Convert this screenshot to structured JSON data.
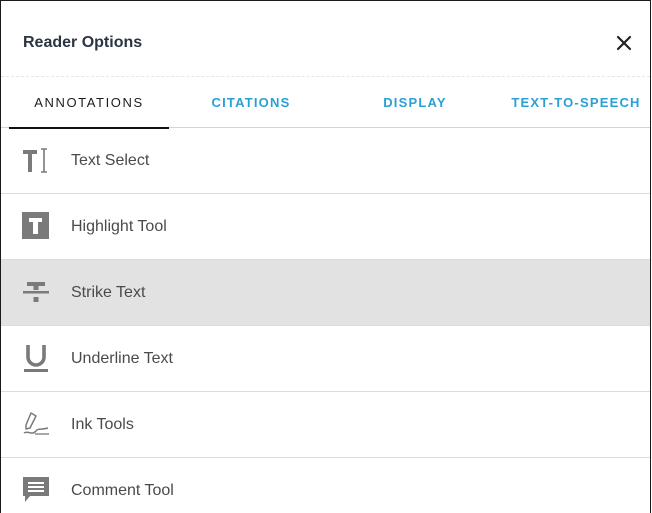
{
  "header": {
    "title": "Reader Options",
    "close_icon": "close-icon"
  },
  "tabs": [
    {
      "label": "ANNOTATIONS",
      "active": true
    },
    {
      "label": "CITATIONS",
      "active": false
    },
    {
      "label": "DISPLAY",
      "active": false
    },
    {
      "label": "TEXT-TO-SPEECH",
      "active": false
    }
  ],
  "tools": [
    {
      "label": "Text Select",
      "icon": "text-select-icon",
      "selected": false
    },
    {
      "label": "Highlight Tool",
      "icon": "highlight-icon",
      "selected": false
    },
    {
      "label": "Strike Text",
      "icon": "strikethrough-icon",
      "selected": true
    },
    {
      "label": "Underline Text",
      "icon": "underline-icon",
      "selected": false
    },
    {
      "label": "Ink Tools",
      "icon": "pen-icon",
      "selected": false
    },
    {
      "label": "Comment Tool",
      "icon": "comment-icon",
      "selected": false
    }
  ],
  "colors": {
    "accent": "#2aa0d6",
    "selected_row": "#e2e2e2",
    "icon": "#7a7a7a",
    "title": "#2a3442"
  }
}
